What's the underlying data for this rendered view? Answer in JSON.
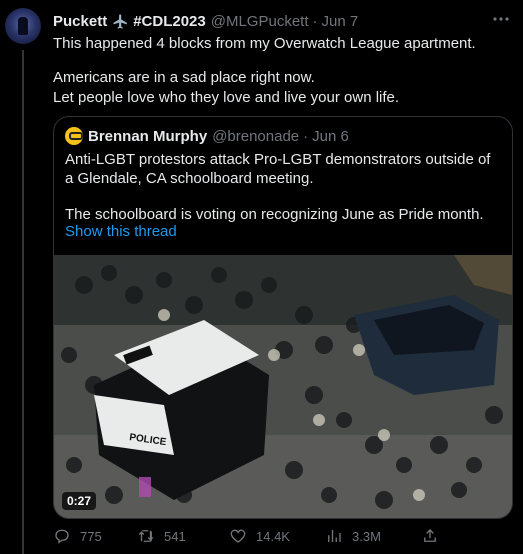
{
  "tweet": {
    "author": {
      "name": "Puckett",
      "name_suffix": "#CDL2023",
      "handle": "@MLGPuckett",
      "date": "Jun 7"
    },
    "text_lines": [
      "This happened 4 blocks from my Overwatch League apartment.",
      "Americans are in a sad place right now.",
      "Let people love who they love and live your own life."
    ],
    "quote": {
      "author_name": "Brennan Murphy",
      "author_handle": "@brenonade",
      "date": "Jun 6",
      "text_lines": [
        "Anti-LGBT protestors attack Pro-LGBT demonstrators outside of a Glendale, CA schoolboard meeting.",
        "The schoolboard is voting on recognizing June as Pride month."
      ],
      "show_thread": "Show this thread",
      "video_duration": "0:27",
      "vehicle_text": "POLICE"
    },
    "actions": {
      "replies": "775",
      "retweets": "541",
      "likes": "14.4K",
      "views": "3.3M"
    },
    "separator": "·"
  },
  "colors": {
    "background": "#000000",
    "text_primary": "#e7e9ea",
    "text_secondary": "#71767b",
    "link": "#1d9bf0",
    "border": "#2f3336"
  },
  "icons": [
    "airplane-icon",
    "more-icon",
    "reply-icon",
    "retweet-icon",
    "like-icon",
    "views-icon",
    "share-icon"
  ]
}
